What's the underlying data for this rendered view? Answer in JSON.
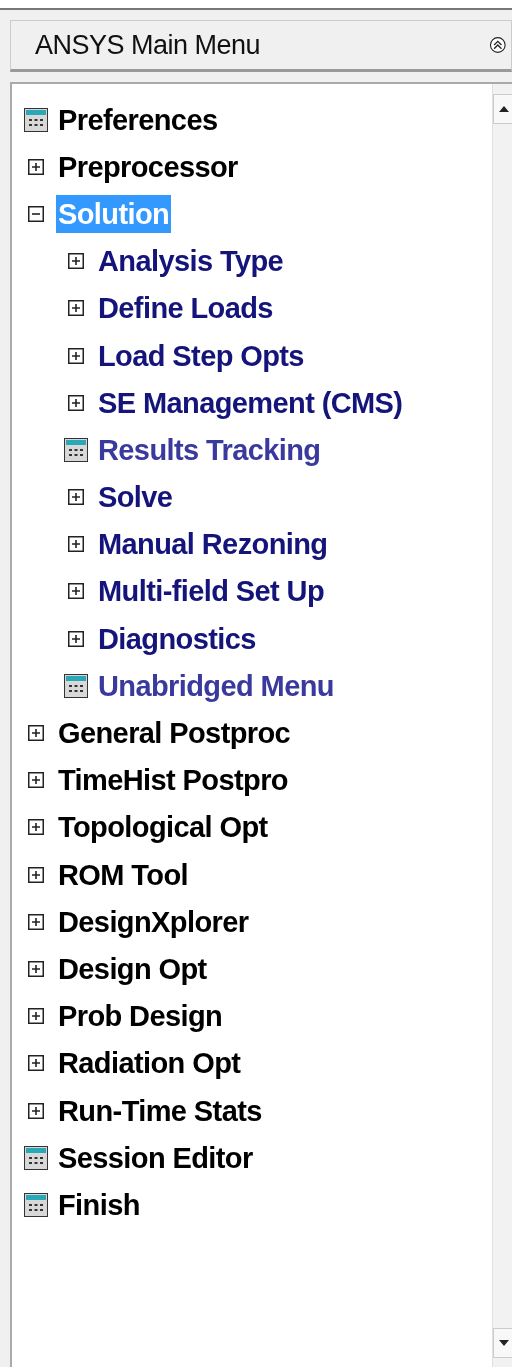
{
  "title": "ANSYS Main Menu",
  "tree": [
    {
      "label": "Preferences",
      "kind": "command",
      "selected": false
    },
    {
      "label": "Preprocessor",
      "kind": "folder",
      "expanded": false,
      "selected": false
    },
    {
      "label": "Solution",
      "kind": "folder",
      "expanded": true,
      "selected": true,
      "children": [
        {
          "label": "Analysis Type",
          "kind": "folder",
          "expanded": false,
          "selected": false
        },
        {
          "label": "Define Loads",
          "kind": "folder",
          "expanded": false,
          "selected": false
        },
        {
          "label": "Load Step Opts",
          "kind": "folder",
          "expanded": false,
          "selected": false
        },
        {
          "label": "SE Management (CMS)",
          "kind": "folder",
          "expanded": false,
          "selected": false
        },
        {
          "label": "Results Tracking",
          "kind": "command",
          "selected": false
        },
        {
          "label": "Solve",
          "kind": "folder",
          "expanded": false,
          "selected": false
        },
        {
          "label": "Manual Rezoning",
          "kind": "folder",
          "expanded": false,
          "selected": false
        },
        {
          "label": "Multi-field Set Up",
          "kind": "folder",
          "expanded": false,
          "selected": false
        },
        {
          "label": "Diagnostics",
          "kind": "folder",
          "expanded": false,
          "selected": false
        },
        {
          "label": "Unabridged Menu",
          "kind": "command",
          "selected": false
        }
      ]
    },
    {
      "label": "General Postproc",
      "kind": "folder",
      "expanded": false,
      "selected": false
    },
    {
      "label": "TimeHist Postpro",
      "kind": "folder",
      "expanded": false,
      "selected": false
    },
    {
      "label": "Topological Opt",
      "kind": "folder",
      "expanded": false,
      "selected": false
    },
    {
      "label": "ROM Tool",
      "kind": "folder",
      "expanded": false,
      "selected": false
    },
    {
      "label": "DesignXplorer",
      "kind": "folder",
      "expanded": false,
      "selected": false
    },
    {
      "label": "Design Opt",
      "kind": "folder",
      "expanded": false,
      "selected": false
    },
    {
      "label": "Prob Design",
      "kind": "folder",
      "expanded": false,
      "selected": false
    },
    {
      "label": "Radiation Opt",
      "kind": "folder",
      "expanded": false,
      "selected": false
    },
    {
      "label": "Run-Time Stats",
      "kind": "folder",
      "expanded": false,
      "selected": false
    },
    {
      "label": "Session Editor",
      "kind": "command",
      "selected": false
    },
    {
      "label": "Finish",
      "kind": "command",
      "selected": false
    }
  ]
}
